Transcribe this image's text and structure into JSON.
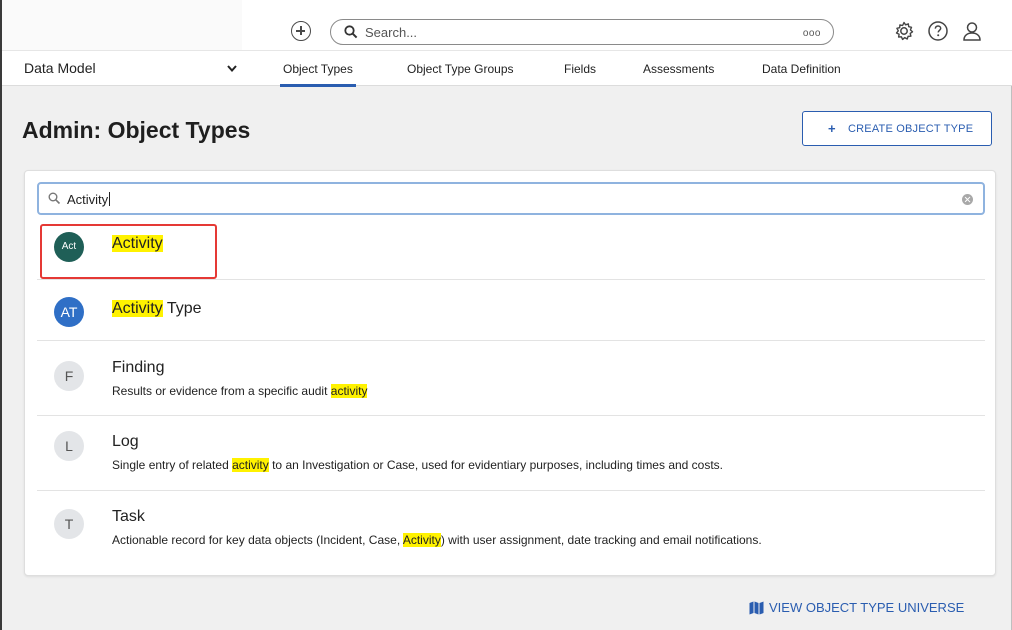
{
  "topbar": {
    "search_placeholder": "Search...",
    "search_more": "ooo",
    "icons": [
      "add-circle-icon",
      "search-icon",
      "settings-icon",
      "help-icon",
      "user-icon"
    ]
  },
  "nav": {
    "section_label": "Data Model",
    "tabs": [
      {
        "label": "Object Types",
        "active": true
      },
      {
        "label": "Object Type Groups",
        "active": false
      },
      {
        "label": "Fields",
        "active": false
      },
      {
        "label": "Assessments",
        "active": false
      },
      {
        "label": "Data Definition",
        "active": false
      }
    ]
  },
  "header": {
    "title": "Admin: Object Types",
    "create_button_icon": "+",
    "create_button": "CREATE OBJECT TYPE"
  },
  "filter": {
    "value": "Activity"
  },
  "results": [
    {
      "avatar": "Act",
      "name_highlight": "Activity",
      "name_rest": "",
      "desc_before": "",
      "desc_highlight": "",
      "desc_after": ""
    },
    {
      "avatar": "AT",
      "name_highlight": "Activity",
      "name_rest": " Type",
      "desc_before": "",
      "desc_highlight": "",
      "desc_after": ""
    },
    {
      "avatar": "F",
      "name_highlight": "",
      "name_rest": "Finding",
      "desc_before": "Results or evidence from a specific audit ",
      "desc_highlight": "activity",
      "desc_after": ""
    },
    {
      "avatar": "L",
      "name_highlight": "",
      "name_rest": "Log",
      "desc_before": "Single entry of related ",
      "desc_highlight": "activity",
      "desc_after": " to an Investigation or Case, used for evidentiary purposes, including times and costs."
    },
    {
      "avatar": "T",
      "name_highlight": "",
      "name_rest": "Task",
      "desc_before": "Actionable record for key data objects (Incident, Case, ",
      "desc_highlight": "Activity",
      "desc_after": ") with user assignment, date tracking and email notifications."
    }
  ],
  "footer": {
    "universe_link": "VIEW OBJECT TYPE UNIVERSE"
  },
  "colors": {
    "accent": "#2a5db0",
    "highlight": "#fff200",
    "selection_box": "#e53935",
    "avatar_act": "#1f5f57",
    "avatar_at": "#2f6fc6"
  }
}
